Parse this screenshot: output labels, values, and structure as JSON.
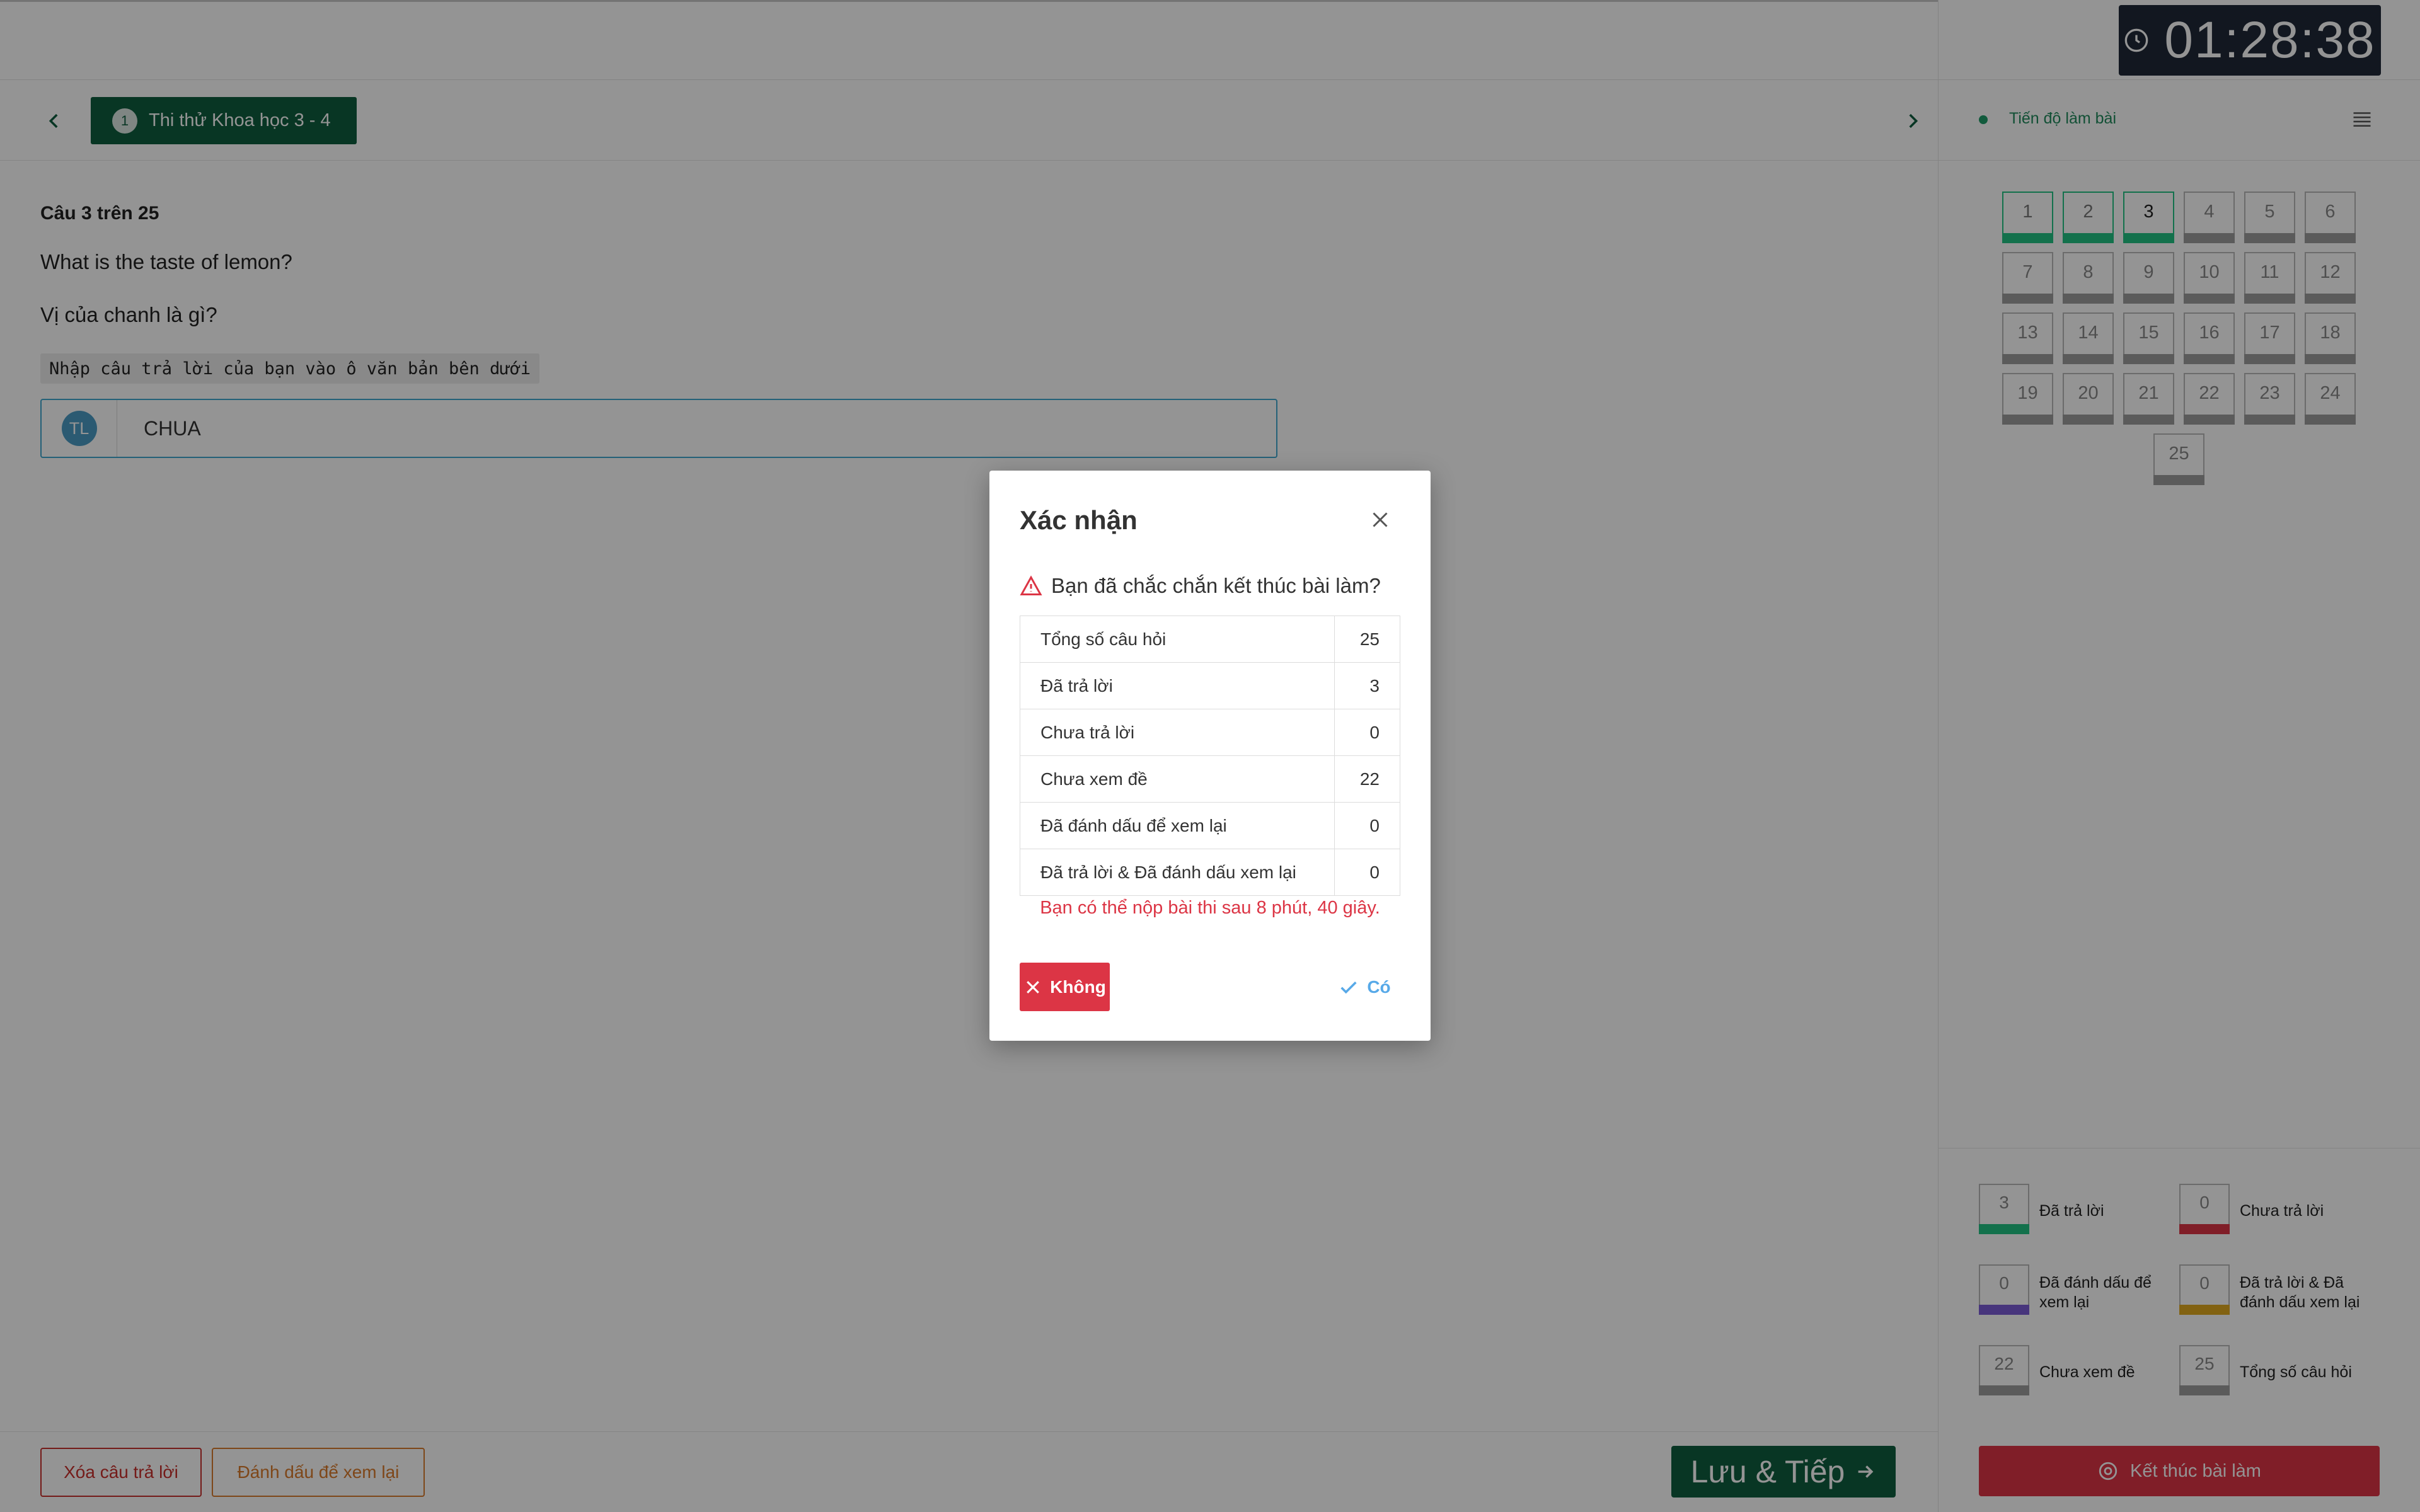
{
  "timer": {
    "value": "01:28:38",
    "icon": "clock-icon"
  },
  "tab": {
    "number": "1",
    "title": "Thi thử Khoa học 3 - 4"
  },
  "question": {
    "index_label": "Câu 3 trên 25",
    "text_en": "What is the taste of lemon?",
    "text_vi": "Vị của chanh là gì?",
    "hint": "Nhập câu trả lời của bạn vào ô văn bản bên dưới",
    "avatar": "TL",
    "answer": "CHUA"
  },
  "bottom": {
    "clear_label": "Xóa câu trả lời",
    "mark_label": "Đánh dấu để xem lại",
    "save_label": "Lưu & Tiếp"
  },
  "progress": {
    "title": "Tiến độ làm bài",
    "questions": [
      {
        "n": "1",
        "state": "answered"
      },
      {
        "n": "2",
        "state": "answered"
      },
      {
        "n": "3",
        "state": "answered"
      },
      {
        "n": "4",
        "state": "unseen"
      },
      {
        "n": "5",
        "state": "unseen"
      },
      {
        "n": "6",
        "state": "unseen"
      },
      {
        "n": "7",
        "state": "unseen"
      },
      {
        "n": "8",
        "state": "unseen"
      },
      {
        "n": "9",
        "state": "unseen"
      },
      {
        "n": "10",
        "state": "unseen"
      },
      {
        "n": "11",
        "state": "unseen"
      },
      {
        "n": "12",
        "state": "unseen"
      },
      {
        "n": "13",
        "state": "unseen"
      },
      {
        "n": "14",
        "state": "unseen"
      },
      {
        "n": "15",
        "state": "unseen"
      },
      {
        "n": "16",
        "state": "unseen"
      },
      {
        "n": "17",
        "state": "unseen"
      },
      {
        "n": "18",
        "state": "unseen"
      },
      {
        "n": "19",
        "state": "unseen"
      },
      {
        "n": "20",
        "state": "unseen"
      },
      {
        "n": "21",
        "state": "unseen"
      },
      {
        "n": "22",
        "state": "unseen"
      },
      {
        "n": "23",
        "state": "unseen"
      },
      {
        "n": "24",
        "state": "unseen"
      },
      {
        "n": "25",
        "state": "unseen"
      }
    ],
    "current": "3"
  },
  "legend": [
    {
      "count": "3",
      "label": "Đã trả lời",
      "color": "#22c383"
    },
    {
      "count": "0",
      "label": "Chưa trả lời",
      "color": "#dc3545"
    },
    {
      "count": "0",
      "label": "Đã đánh dấu để xem lại",
      "color": "#7b5cd6"
    },
    {
      "count": "0",
      "label": "Đã trả lời & Đã đánh dấu xem lại",
      "color": "#e0a91f"
    },
    {
      "count": "22",
      "label": "Chưa xem đề",
      "color": "#9e9e9e"
    },
    {
      "count": "25",
      "label": "Tổng số câu hỏi",
      "color": "#9e9e9e"
    }
  ],
  "finish_label": "Kết thúc bài làm",
  "modal": {
    "title": "Xác nhận",
    "question": "Bạn đã chắc chắn kết thúc bài làm?",
    "rows": [
      {
        "label": "Tổng số câu hỏi",
        "value": "25"
      },
      {
        "label": "Đã trả lời",
        "value": "3"
      },
      {
        "label": "Chưa trả lời",
        "value": "0"
      },
      {
        "label": "Chưa xem đề",
        "value": "22"
      },
      {
        "label": "Đã đánh dấu để xem lại",
        "value": "0"
      },
      {
        "label": "Đã trả lời & Đã đánh dấu xem lại",
        "value": "0"
      }
    ],
    "note": "Bạn có thể nộp bài thi sau 8 phút, 40 giây.",
    "no_label": "Không",
    "yes_label": "Có"
  },
  "colors": {
    "primary_green": "#0f5d3e",
    "answered_green": "#22c383",
    "danger_red": "#dc3545",
    "info_blue": "#57a9e8",
    "timer_bg": "#1f2937"
  }
}
